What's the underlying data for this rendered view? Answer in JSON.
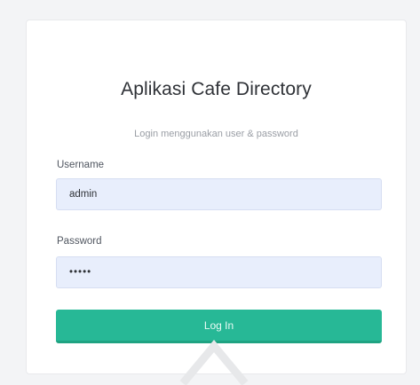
{
  "login": {
    "title": "Aplikasi Cafe Directory",
    "subtitle": "Login menggunakan user & password",
    "username_label": "Username",
    "username_value": "admin",
    "password_label": "Password",
    "password_value": "admin",
    "submit_label": "Log In"
  },
  "colors": {
    "page_background": "#f3f4f6",
    "input_background": "#e8eefc",
    "button": "#27b896"
  }
}
